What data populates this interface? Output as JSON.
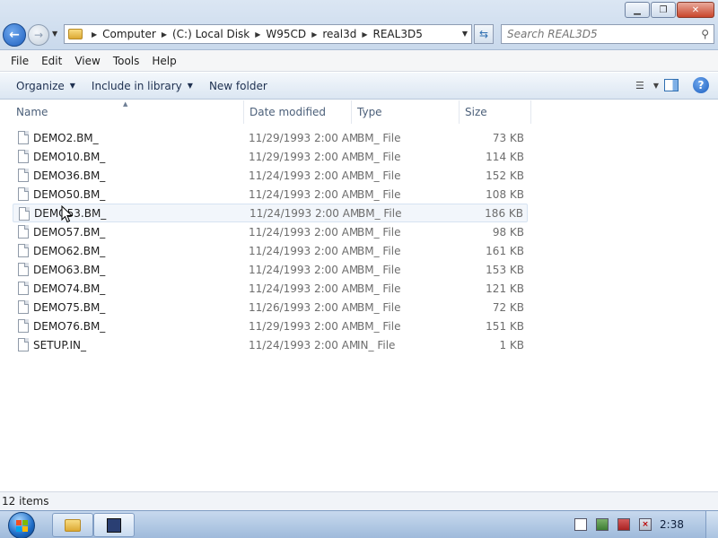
{
  "window": {
    "controls": {
      "minimize": "▁",
      "maximize": "❐",
      "close": "✕"
    }
  },
  "address": {
    "crumbs": [
      "Computer",
      "(C:) Local Disk",
      "W95CD",
      "real3d",
      "REAL3D5"
    ]
  },
  "search": {
    "placeholder": "Search REAL3D5"
  },
  "menu": {
    "items": [
      "File",
      "Edit",
      "View",
      "Tools",
      "Help"
    ]
  },
  "toolbar": {
    "organize": "Organize",
    "include_in_library": "Include in library",
    "new_folder": "New folder"
  },
  "columns": {
    "name": "Name",
    "date": "Date modified",
    "type": "Type",
    "size": "Size"
  },
  "files": [
    {
      "name": "DEMO2.BM_",
      "date": "11/29/1993 2:00 AM",
      "type": "BM_ File",
      "size": "73 KB"
    },
    {
      "name": "DEMO10.BM_",
      "date": "11/29/1993 2:00 AM",
      "type": "BM_ File",
      "size": "114 KB"
    },
    {
      "name": "DEMO36.BM_",
      "date": "11/24/1993 2:00 AM",
      "type": "BM_ File",
      "size": "152 KB"
    },
    {
      "name": "DEMO50.BM_",
      "date": "11/24/1993 2:00 AM",
      "type": "BM_ File",
      "size": "108 KB"
    },
    {
      "name": "DEMO53.BM_",
      "date": "11/24/1993 2:00 AM",
      "type": "BM_ File",
      "size": "186 KB"
    },
    {
      "name": "DEMO57.BM_",
      "date": "11/24/1993 2:00 AM",
      "type": "BM_ File",
      "size": "98 KB"
    },
    {
      "name": "DEMO62.BM_",
      "date": "11/24/1993 2:00 AM",
      "type": "BM_ File",
      "size": "161 KB"
    },
    {
      "name": "DEMO63.BM_",
      "date": "11/24/1993 2:00 AM",
      "type": "BM_ File",
      "size": "153 KB"
    },
    {
      "name": "DEMO74.BM_",
      "date": "11/24/1993 2:00 AM",
      "type": "BM_ File",
      "size": "121 KB"
    },
    {
      "name": "DEMO75.BM_",
      "date": "11/26/1993 2:00 AM",
      "type": "BM_ File",
      "size": "72 KB"
    },
    {
      "name": "DEMO76.BM_",
      "date": "11/29/1993 2:00 AM",
      "type": "BM_ File",
      "size": "151 KB"
    },
    {
      "name": "SETUP.IN_",
      "date": "11/24/1993 2:00 AM",
      "type": "IN_ File",
      "size": "1 KB"
    }
  ],
  "status": {
    "item_count": "12 items"
  },
  "taskbar": {
    "clock": "2:38"
  },
  "icons": {
    "back": "back-arrow-icon",
    "forward": "forward-arrow-icon",
    "search": "magnifier-icon",
    "file": "document-icon",
    "help": "question-mark-icon"
  },
  "colors": {
    "accent": "#1d5fbf",
    "taskbar": "#9fbadb",
    "header_text": "#4c607a"
  }
}
